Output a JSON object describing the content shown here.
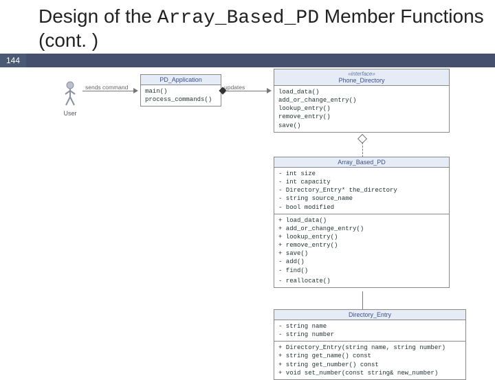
{
  "slide": {
    "title_prefix": "Design of the ",
    "title_code": "Array_Based_PD",
    "title_suffix": " Member Functions (cont. )",
    "page_number": "144"
  },
  "actor": {
    "label": "User"
  },
  "assoc": {
    "sends": "sends command",
    "updates": "updates"
  },
  "pd_app": {
    "name": "PD_Application",
    "ops": [
      "main()",
      "process_commands()"
    ]
  },
  "phone_dir": {
    "stereo": "«interface»",
    "name": "Phone_Directory",
    "ops": [
      "load_data()",
      "add_or_change_entry()",
      "lookup_entry()",
      "remove_entry()",
      "save()"
    ]
  },
  "abpd": {
    "name": "Array_Based_PD",
    "attrs": [
      "- int size",
      "- int capacity",
      "- Directory_Entry* the_directory",
      "- string source_name",
      "- bool modified"
    ],
    "ops": [
      "+ load_data()",
      "+ add_or_change_entry()",
      "+ lookup_entry()",
      "+ remove_entry()",
      "+ save()",
      "- add()",
      "- find()",
      "- reallocate()"
    ]
  },
  "dir_entry": {
    "name": "Directory_Entry",
    "attrs": [
      "- string name",
      "- string number"
    ],
    "ops": [
      "+ Directory_Entry(string name, string number)",
      "+ string get_name() const",
      "+ string get_number() const",
      "+ void set_number(const string& new_number)"
    ]
  }
}
